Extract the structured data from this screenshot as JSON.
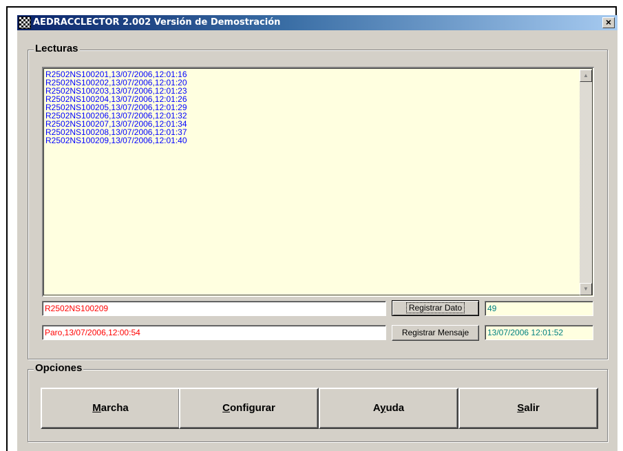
{
  "window": {
    "title": "AEDRACCLECTOR 2.002  Versión de Demostración",
    "close_glyph": "×"
  },
  "lecturas": {
    "label": "Lecturas",
    "lines": [
      "R2502NS100201,13/07/2006,12:01:16",
      "R2502NS100202,13/07/2006,12:01:20",
      "R2502NS100203,13/07/2006,12:01:23",
      "R2502NS100204,13/07/2006,12:01:26",
      "R2502NS100205,13/07/2006,12:01:29",
      "R2502NS100206,13/07/2006,12:01:32",
      "R2502NS100207,13/07/2006,12:01:34",
      "R2502NS100208,13/07/2006,12:01:37",
      "R2502NS100209,13/07/2006,12:01:40"
    ],
    "dato_value": "R2502NS100209",
    "mensaje_value": "Paro,13/07/2006,12:00:54",
    "count_value": "49",
    "datetime_value": "13/07/2006 12:01:52",
    "registrar_dato_label": "Registrar Dato",
    "registrar_mensaje_label": "Registrar Mensaje",
    "scroll_up_glyph": "▲",
    "scroll_down_glyph": "▼"
  },
  "opciones": {
    "label": "Opciones",
    "buttons": [
      {
        "accel": "M",
        "rest": "archa"
      },
      {
        "accel": "C",
        "rest": "onfigurar"
      },
      {
        "pre": "A",
        "accel": "y",
        "rest": "uda"
      },
      {
        "accel": "S",
        "rest": "alir"
      }
    ]
  },
  "colors": {
    "list_text": "#0000ff",
    "field_red": "#ff0000",
    "field_teal": "#008080",
    "list_bg": "#ffffe0",
    "window_bg": "#d4d0c8"
  }
}
